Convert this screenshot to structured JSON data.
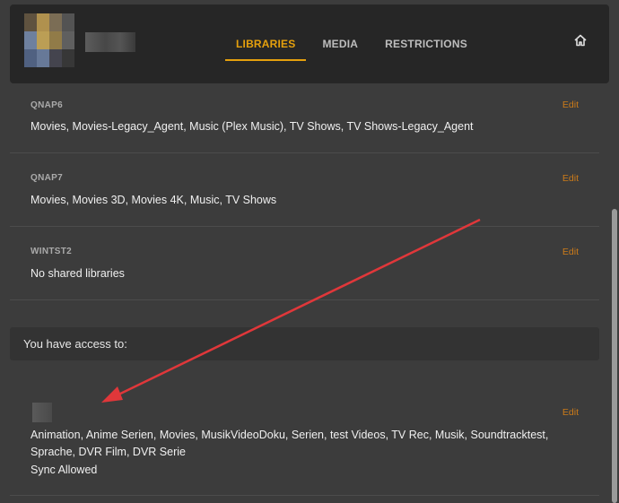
{
  "header": {
    "tabs": [
      {
        "label": "LIBRARIES",
        "active": true
      },
      {
        "label": "MEDIA",
        "active": false
      },
      {
        "label": "RESTRICTIONS",
        "active": false
      }
    ],
    "home_icon": "home-icon"
  },
  "servers": [
    {
      "name": "QNAP6",
      "libraries": "Movies, Movies-Legacy_Agent, Music (Plex Music), TV Shows, TV Shows-Legacy_Agent",
      "edit": "Edit"
    },
    {
      "name": "QNAP7",
      "libraries": "Movies, Movies 3D, Movies 4K, Music, TV Shows",
      "edit": "Edit"
    },
    {
      "name": "WINTST2",
      "libraries": "No shared libraries",
      "edit": "Edit"
    }
  ],
  "access": {
    "heading": "You have access to:",
    "item": {
      "libraries": "Animation, Anime Serien, Movies, MusikVideoDoku, Serien, test Videos, TV Rec, Musik, Soundtracktest, Sprache, DVR Film, DVR Serie",
      "sync": "Sync Allowed",
      "edit": "Edit"
    }
  },
  "colors": {
    "accent": "#e5a00d",
    "edit": "#cc7b19",
    "arrow": "#e0373a"
  }
}
